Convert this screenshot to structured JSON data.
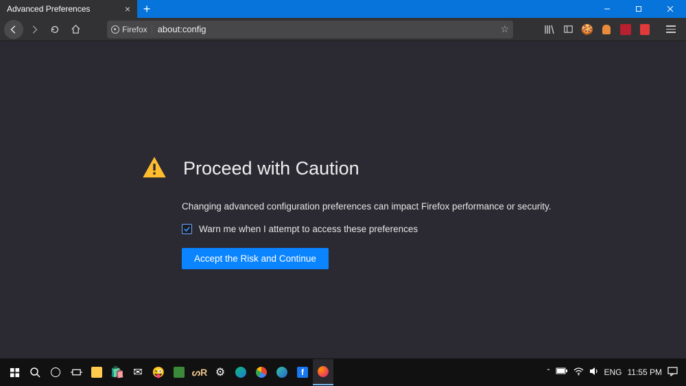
{
  "titlebar": {
    "tab_title": "Advanced Preferences"
  },
  "urlbar": {
    "identity_label": "Firefox",
    "url": "about:config"
  },
  "page": {
    "heading": "Proceed with Caution",
    "body": "Changing advanced configuration preferences can impact Firefox performance or security.",
    "checkbox_label": "Warn me when I attempt to access these preferences",
    "checkbox_checked": true,
    "button_label": "Accept the Risk and Continue"
  },
  "taskbar": {
    "lang": "ENG",
    "time": "11:55 PM"
  }
}
